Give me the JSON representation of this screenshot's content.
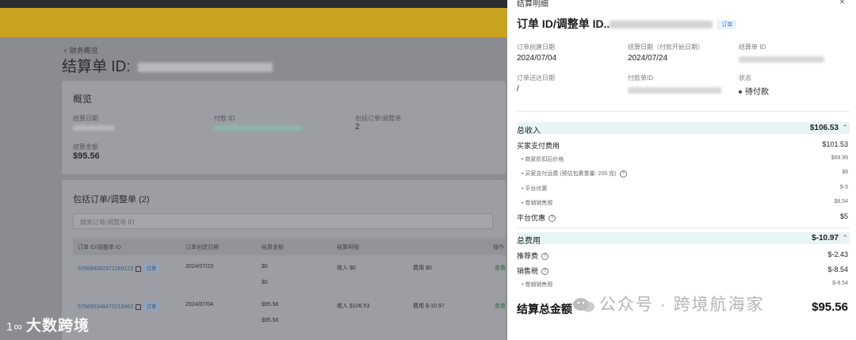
{
  "background": {
    "back_link": "< 财务概览",
    "title": "结算单 ID:",
    "overview": {
      "title": "概览",
      "settle_date_label": "结算日期",
      "payment_id_label": "付款 ID",
      "included_orders_label": "包括订单/调整单",
      "included_orders_value": "2",
      "settle_amount_label": "结算金额",
      "settle_amount_value": "$95.56"
    },
    "orders": {
      "title": "包括订单/调整单 (2)",
      "search_placeholder": "搜索订单/调整单 ID",
      "headers": [
        "订单 ID/调整单 ID",
        "订单创建日期",
        "结算金额",
        "结算明细",
        "操作"
      ],
      "rows": [
        {
          "id": "576684082371269123",
          "tag": "订单",
          "date": "2024/07/23",
          "amount": "$0",
          "amount2": "$0",
          "income": "收入 $0",
          "fee": "费用 $0",
          "action": "查看"
        },
        {
          "id": "576695348479210463",
          "tag": "订单",
          "date": "2024/07/04",
          "amount": "$95.56",
          "amount2": "$95.56",
          "income": "收入 $106.53",
          "fee": "费用 $-10.97",
          "action": "查看"
        }
      ]
    }
  },
  "watermark": {
    "left_logo": "1∞",
    "left_text": "大数跨境",
    "right_text": "公众号 · 跨境航海家"
  },
  "drawer": {
    "header": "结算明细",
    "close": "×",
    "title_prefix": "订单 ID/调整单 ID..",
    "title_tag": "订单",
    "fields": {
      "order_created_label": "订单创建日期",
      "order_created_value": "2024/07/04",
      "settle_date_label": "结算日期（付款开始日期）",
      "settle_date_value": "2024/07/24",
      "settle_id_label": "结算单 ID",
      "delivered_label": "订单送达日期",
      "delivered_value": "/",
      "payment_id_label": "付款单ID",
      "status_label": "状态",
      "status_value": "待付款"
    },
    "income": {
      "label": "总收入",
      "value": "$106.53",
      "rows": [
        {
          "label": "买家支付费用",
          "value": "$101.53",
          "sub": false
        },
        {
          "label": "• 商家折扣后价格",
          "value": "$89.99",
          "sub": true
        },
        {
          "label": "• 买家支付运费 (预估包裹重量: 200 克)",
          "value": "$8",
          "sub": true,
          "help": true
        },
        {
          "label": "• 平台优惠",
          "value": "$-5",
          "sub": true
        },
        {
          "label": "• 卷销销售税",
          "value": "$8.54",
          "sub": true
        },
        {
          "label": "平台优惠",
          "value": "$5",
          "sub": false,
          "help": true
        }
      ]
    },
    "expense": {
      "label": "总费用",
      "value": "$-10.97",
      "rows": [
        {
          "label": "推荐费",
          "value": "$-2.43",
          "sub": false,
          "help": true
        },
        {
          "label": "销售税",
          "value": "$-8.54",
          "sub": false,
          "help": true
        },
        {
          "label": "• 卷销销售税",
          "value": "$-8.54",
          "sub": true
        }
      ]
    },
    "total": {
      "label": "结算总金额",
      "value": "$95.56"
    }
  }
}
